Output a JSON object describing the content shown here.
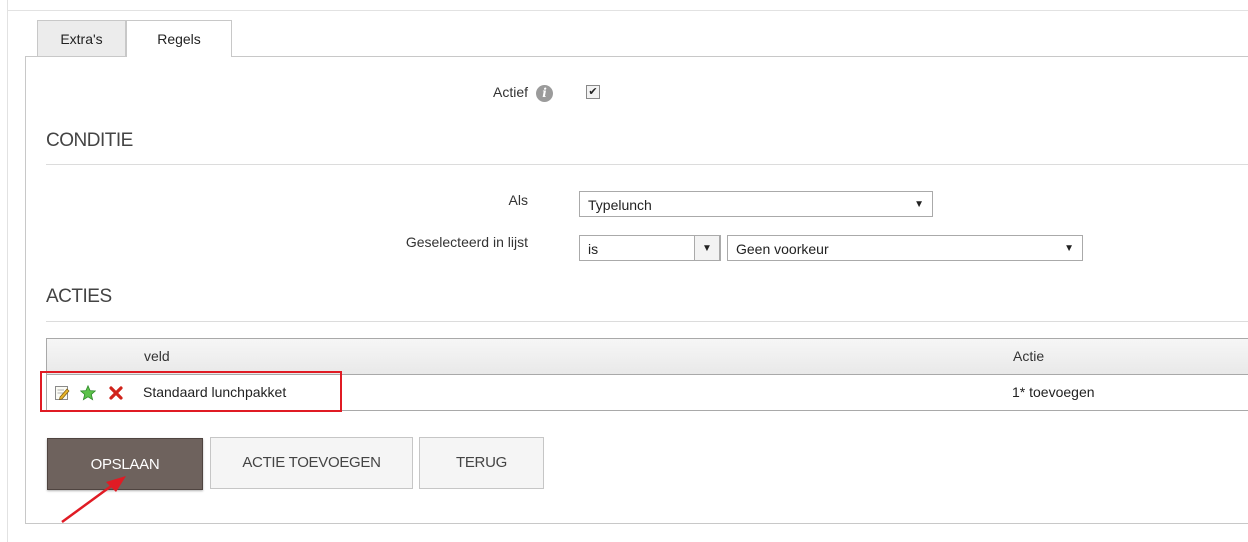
{
  "tabs": [
    "Extra's",
    "Regels"
  ],
  "actief": {
    "label": "Actief",
    "checked": true
  },
  "sections": {
    "conditie": "CONDITIE",
    "acties": "ACTIES"
  },
  "conditie": {
    "als_label": "Als",
    "als_value": "Typelunch",
    "geselecteerd_label": "Geselecteerd in lijst",
    "operator_value": "is",
    "list_value": "Geen voorkeur"
  },
  "grid": {
    "headers": [
      "veld",
      "Actie"
    ],
    "rows": [
      {
        "veld": "Standaard lunchpakket",
        "actie": "1* toevoegen"
      }
    ]
  },
  "buttons": {
    "save": "OPSLAAN",
    "add_action": "ACTIE TOEVOEGEN",
    "back": "TERUG"
  },
  "colors": {
    "primary_button": "#6e625d",
    "highlight": "#e01b24",
    "star": "#5cc24a"
  },
  "icons": [
    "info-icon",
    "checkbox-check-icon",
    "chevron-down-icon",
    "edit-icon",
    "star-icon",
    "delete-icon",
    "arrow-annotation"
  ]
}
